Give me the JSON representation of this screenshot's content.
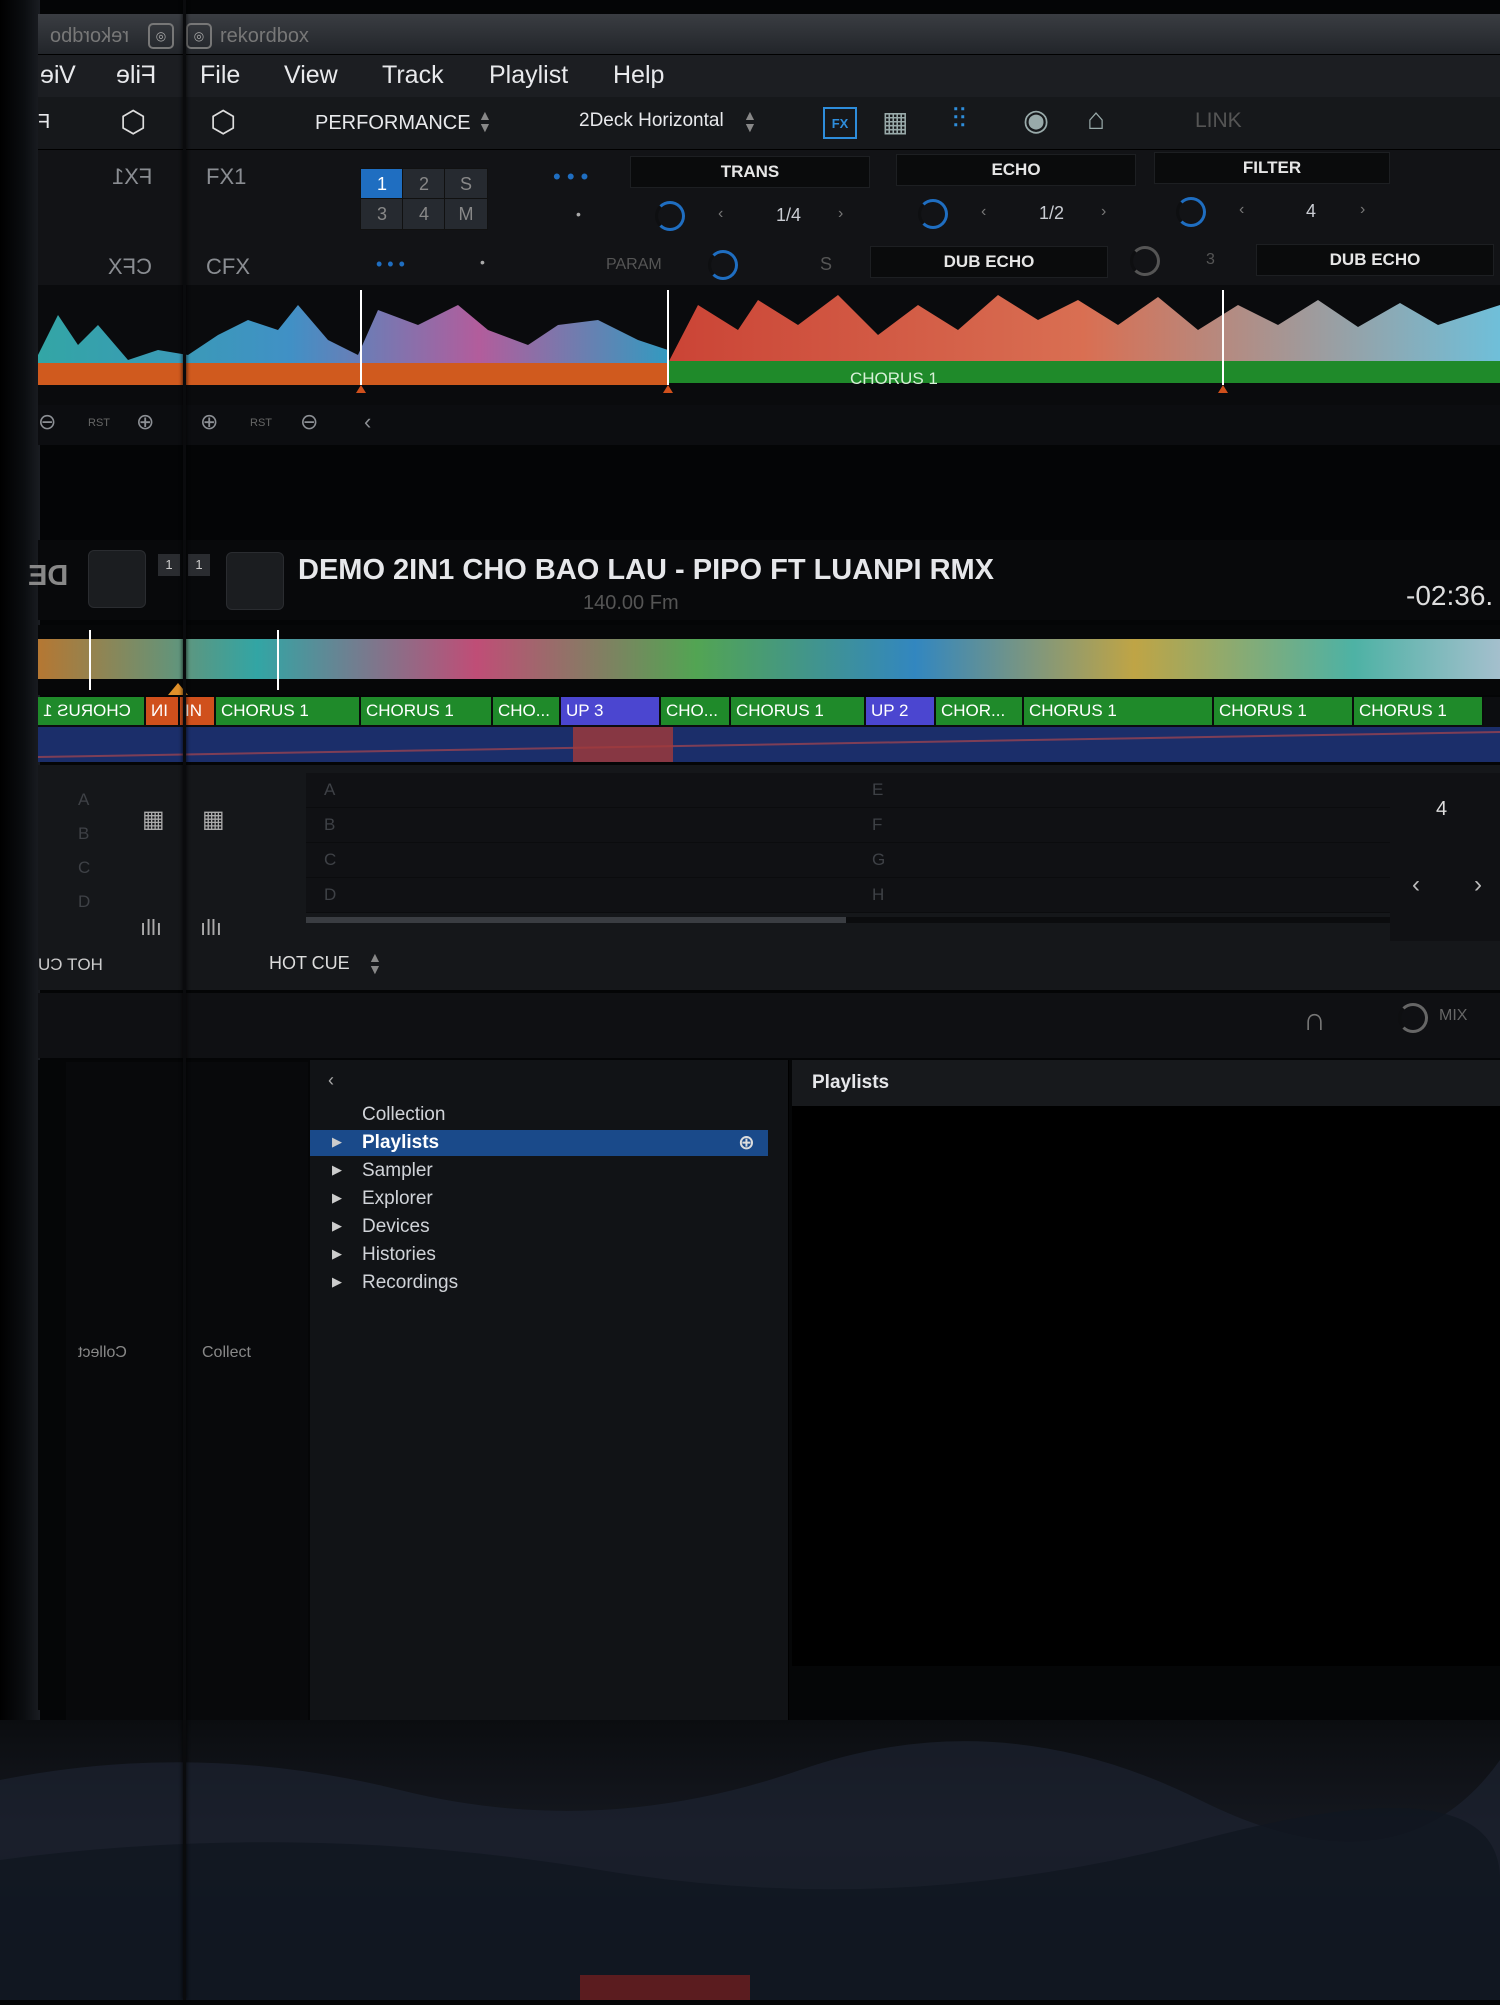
{
  "window": {
    "app_name": "rekordbox",
    "mirror_app_name": "rekordbo"
  },
  "menu": {
    "mirror_items": [
      "Vie",
      "File"
    ],
    "items": [
      "File",
      "View",
      "Track",
      "Playlist",
      "Help"
    ]
  },
  "toolbar": {
    "mode": "PERFORMANCE",
    "layout": "2Deck Horizontal",
    "link": "LINK",
    "fx_badge": "FX",
    "mirror_letter": "F"
  },
  "fx": {
    "label": "FX1",
    "mirror_label": "FX1",
    "grid": [
      "1",
      "2",
      "S",
      "3",
      "4",
      "M"
    ],
    "units": [
      {
        "name": "TRANS",
        "value": "1/4"
      },
      {
        "name": "ECHO",
        "value": "1/2"
      },
      {
        "name": "FILTER",
        "value": "4"
      }
    ],
    "cfx_label": "CFX",
    "mirror_cfx": "CFX",
    "param": "PARAM",
    "s_label": "S",
    "dub1": "DUB ECHO",
    "dub_value": "3",
    "dub2": "DUB ECHO"
  },
  "wave_top": {
    "chorus_label": "CHORUS 1",
    "rst": "RST"
  },
  "deck": {
    "title": "DEMO 2IN1 CHO BAO LAU - PIPO FT LUANPI RMX",
    "bpm_text": "140.00 Fm",
    "time": "-02:36.",
    "deck_badge_1": "1",
    "deck_badge_2": "1",
    "mirror_de": "DE"
  },
  "cues": [
    {
      "label": "CHORUS 1",
      "color": "#1f8a2a",
      "mirror": true
    },
    {
      "label": "IN",
      "color": "#d0501c",
      "mirror": true
    },
    {
      "label": "IN",
      "color": "#d0501c",
      "mirror": false
    },
    {
      "label": "CHORUS 1",
      "color": "#1f8a2a",
      "mirror": false
    },
    {
      "label": "CHORUS 1",
      "color": "#1f8a2a",
      "mirror": false
    },
    {
      "label": "CHO...",
      "color": "#1f8a2a",
      "mirror": false
    },
    {
      "label": "UP 3",
      "color": "#4b46d0",
      "mirror": false
    },
    {
      "label": "CHO...",
      "color": "#1f8a2a",
      "mirror": false
    },
    {
      "label": "CHORUS 1",
      "color": "#1f8a2a",
      "mirror": false
    },
    {
      "label": "UP 2",
      "color": "#4b46d0",
      "mirror": false
    },
    {
      "label": "CHOR...",
      "color": "#1f8a2a",
      "mirror": false
    },
    {
      "label": "CHORUS 1",
      "color": "#1f8a2a",
      "mirror": false
    },
    {
      "label": "CHORUS 1",
      "color": "#1f8a2a",
      "mirror": false
    },
    {
      "label": "CHORUS 1",
      "color": "#1f8a2a",
      "mirror": false
    }
  ],
  "hotcue": {
    "letters_left": [
      "A",
      "B",
      "C",
      "D"
    ],
    "letters_right": [
      "E",
      "F",
      "G",
      "H"
    ],
    "mode": "HOT CUE",
    "mirror_mode": "HOT CU",
    "side_value": "4"
  },
  "mixer": {
    "mix_label": "MIX"
  },
  "browser": {
    "tree": [
      "Collection",
      "Playlists",
      "Sampler",
      "Explorer",
      "Devices",
      "Histories",
      "Recordings"
    ],
    "selected": 1,
    "header": "Playlists",
    "side_labels": [
      "Collect",
      "Collect"
    ]
  },
  "colors": {
    "accent": "#1f6ec1",
    "chorus": "#1f8a2a",
    "in": "#d0501c",
    "up": "#4b46d0",
    "orange": "#d05a1e"
  }
}
